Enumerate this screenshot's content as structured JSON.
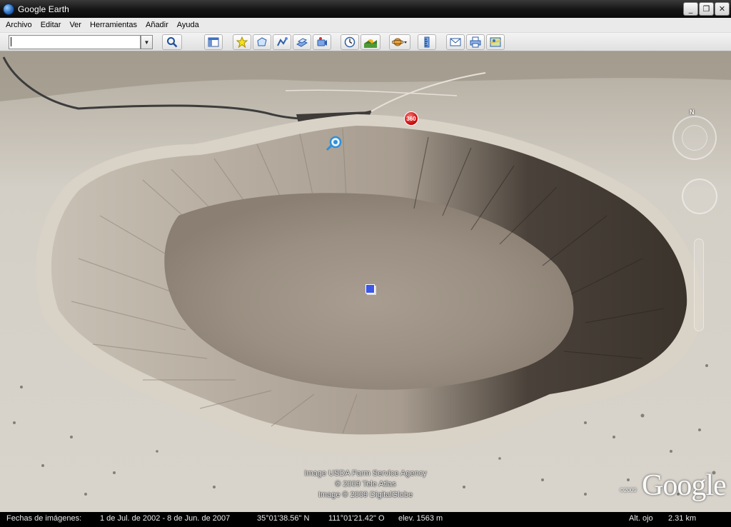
{
  "window": {
    "title": "Google Earth",
    "controls": {
      "minimize": "_",
      "restore": "❐",
      "close": "✕"
    }
  },
  "menu": {
    "items": [
      "Archivo",
      "Editar",
      "Ver",
      "Herramientas",
      "Añadir",
      "Ayuda"
    ]
  },
  "toolbar": {
    "search_value": "",
    "icons": [
      "sidebar-toggle-icon",
      "placemark-icon",
      "polygon-icon",
      "path-icon",
      "image-overlay-icon",
      "record-tour-icon",
      "historical-imagery-icon",
      "sunlight-icon",
      "planets-icon",
      "ruler-icon",
      "email-icon",
      "print-icon",
      "view-in-maps-icon"
    ]
  },
  "map": {
    "compass_north": "N",
    "marker_360": "360",
    "credits": {
      "line1": "Image USDA Farm Service Agency",
      "line2": "© 2009 Tele Atlas",
      "line3": "Image © 2009 DigitalGlobe"
    },
    "logo_copyright": "©2009",
    "logo": "Google"
  },
  "status": {
    "imagery_dates": "Fechas de imágenes:",
    "date_range": "1 de Jul. de 2002 - 8 de Jun. de 2007",
    "latitude": "35°01'38.56\" N",
    "longitude": "111°01'21.42\" O",
    "elevation": "elev.  1563 m",
    "eye_alt_label": "Alt. ojo",
    "eye_alt_value": "2.31 km"
  },
  "colors": {
    "titlebar": "#141414",
    "menubar": "#eaeaea",
    "statusbar": "#000000",
    "marker_square": "#3c56e8",
    "marker_360": "#d01010"
  }
}
